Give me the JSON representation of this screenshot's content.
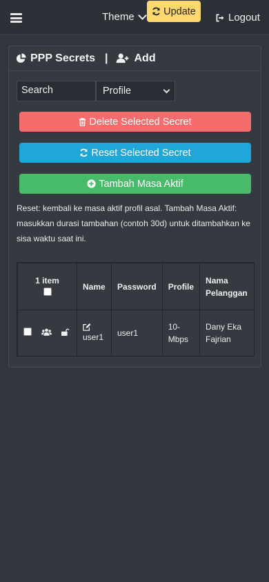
{
  "navbar": {
    "theme_label": "Theme",
    "update_label": "Update",
    "logout_label": "Logout"
  },
  "card": {
    "title": "PPP Secrets",
    "separator": "|",
    "add_label": "Add"
  },
  "filters": {
    "search_placeholder": "Search",
    "profile_selected": "Profile"
  },
  "buttons": {
    "delete_label": "Delete Selected Secret",
    "reset_label": "Reset Selected Secret",
    "tambah_label": "Tambah Masa Aktif"
  },
  "note": "Reset: kembali ke masa aktif profil asal. Tambah Masa Aktif: masukkan durasi tambahan (contoh 30d) untuk ditambahkan ke sisa waktu saat ini.",
  "table": {
    "headers": {
      "count": "1 item",
      "name": "Name",
      "password": "Password",
      "profile": "Profile",
      "nama_pelanggan": "Nama Pelanggan"
    },
    "rows": [
      {
        "name": "user1",
        "password": "user1",
        "profile": "10-Mbps",
        "nama_pelanggan": "Dany Eka Fajrian"
      }
    ]
  },
  "colors": {
    "update": "#ffd970",
    "delete": "#f56c6c",
    "reset": "#1ea7d8",
    "tambah": "#48bb6a"
  }
}
